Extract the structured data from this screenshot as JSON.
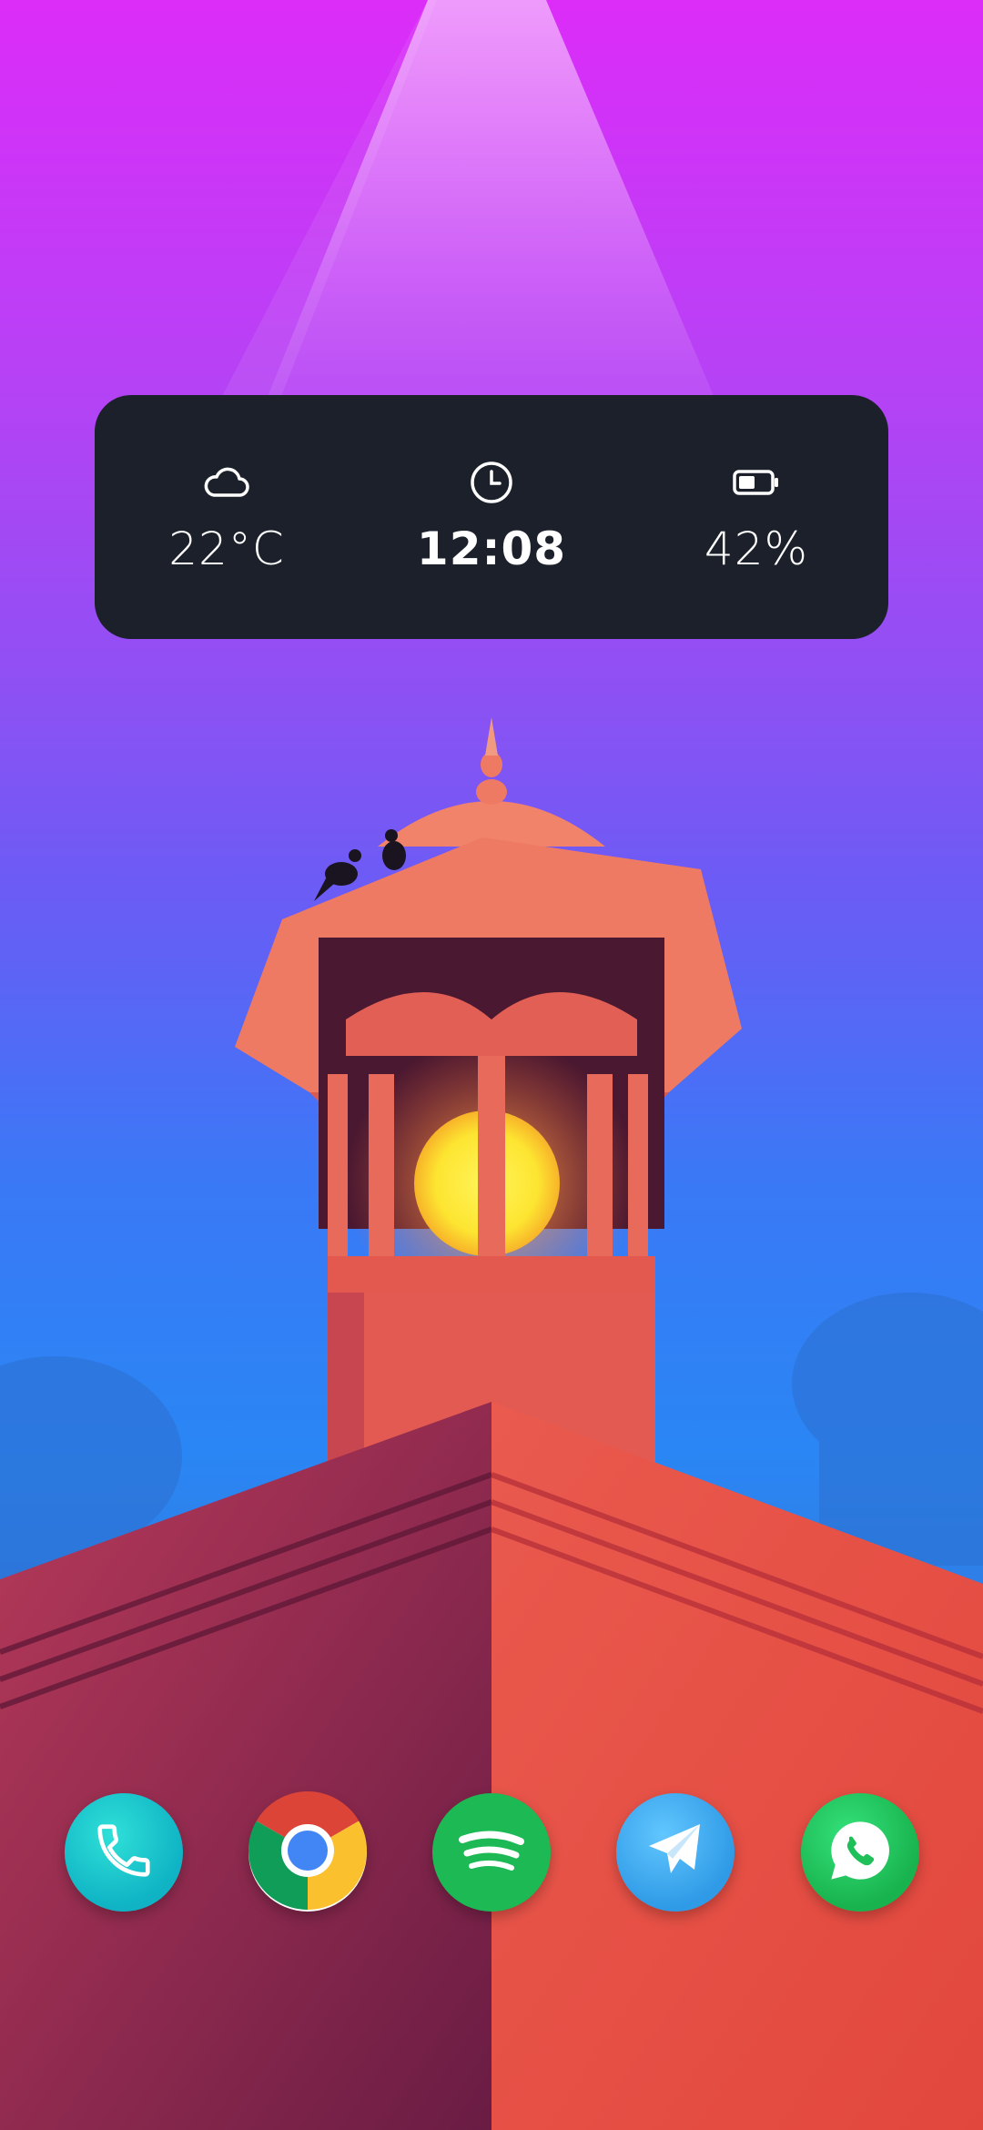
{
  "widget": {
    "weather": {
      "icon": "cloud-icon",
      "value": "22°C"
    },
    "clock": {
      "icon": "clock-icon",
      "value": "12:08"
    },
    "battery": {
      "icon": "battery-icon",
      "value": "42%"
    }
  },
  "dock": [
    {
      "name": "phone",
      "icon": "phone-icon",
      "color": "#16c4c9"
    },
    {
      "name": "chrome",
      "icon": "chrome-icon",
      "color": "#db4437"
    },
    {
      "name": "spotify",
      "icon": "spotify-icon",
      "color": "#1db954"
    },
    {
      "name": "telegram",
      "icon": "telegram-icon",
      "color": "#3ea9f0"
    },
    {
      "name": "whatsapp",
      "icon": "whatsapp-icon",
      "color": "#25d366"
    }
  ]
}
